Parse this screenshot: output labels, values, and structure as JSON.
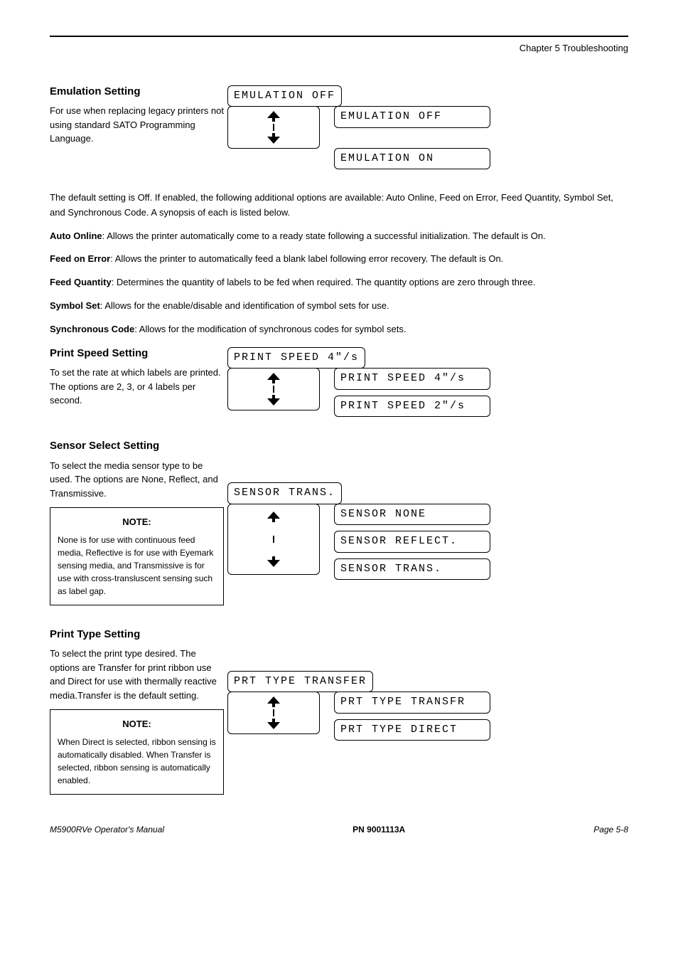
{
  "header": {
    "chapter": "Chapter 5 Troubleshooting"
  },
  "emulation": {
    "title": "Emulation Setting",
    "desc": "For use when replacing legacy printers not using standard SATO Programming Language.",
    "lcd_main": "EMULATION  OFF",
    "opt1": "EMULATION  OFF",
    "opt2": "EMULATION  ON",
    "note_pre": "The default setting is Off. If enabled, the following additional options are available: Auto Online, Feed on Error, Feed Quantity, Symbol Set, and Synchronous Code. A synopsis of each is listed below.",
    "auto_online": "Allows the printer automatically come to a ready state following a successful initialization. The default is On.",
    "feed_on_error": "Allows the printer to automatically feed a blank label following error recovery. The default is On.",
    "feed_quantity": "Determines the quantity of labels to be fed when required. The quantity options are zero through three.",
    "symbol_set": "Allows for the enable/disable and identification of symbol sets for use.",
    "sync_code": "Allows for the modification of synchronous codes for symbol sets.",
    "auto_label": "Auto Online",
    "feed_err_label": "Feed on Error",
    "feed_qty_label": "Feed Quantity",
    "symbol_label": "Symbol Set",
    "sync_label": "Synchronous Code"
  },
  "print_speed": {
    "title": "Print Speed Setting",
    "desc": "To set the rate at which labels are printed. The options are 2, 3, or 4 labels per second.",
    "lcd_main": "PRINT SPEED 4\"/s",
    "opt1": "PRINT SPEED 4\"/s",
    "opt2": "PRINT SPEED 2\"/s"
  },
  "sensor": {
    "title": "Sensor Select Setting",
    "desc": "To select the media sensor type to be used. The options are None, Reflect, and Transmissive.",
    "lcd_main": "SENSOR TRANS.",
    "opt1": "SENSOR NONE",
    "opt2": "SENSOR REFLECT.",
    "opt3": "SENSOR TRANS.",
    "note_title": "NOTE:",
    "note_text": "None is for use with continuous feed media, Reflective is for use with Eyemark sensing media, and Transmissive is for use with cross-transluscent sensing such as label gap."
  },
  "print_type": {
    "title": "Print Type Setting",
    "desc": "To select the print type desired. The options are Transfer for print ribbon use and Direct for use with thermally reactive media.Transfer is the default setting.",
    "lcd_main": "PRT TYPE TRANSFER",
    "opt1": "PRT TYPE TRANSFR",
    "opt2": "PRT TYPE DIRECT",
    "note_title": "NOTE:",
    "note_text": "When Direct is selected, ribbon sensing is automatically disabled. When Transfer is selected, ribbon sensing is automatically enabled."
  },
  "footer": {
    "left": "M5900RVe Operator's Manual",
    "right": "PN 9001113A",
    "page": "Page 5-8"
  }
}
